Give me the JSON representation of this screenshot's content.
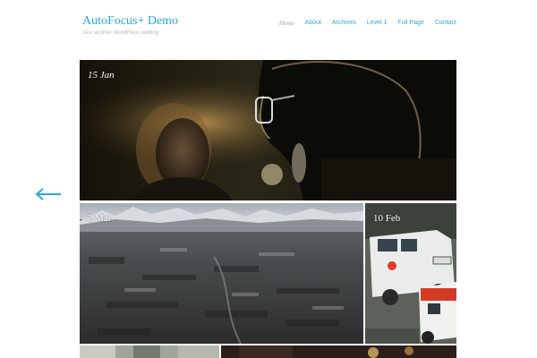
{
  "site": {
    "title": "AutoFocus+ Demo",
    "description": "Just another WordPress weblog"
  },
  "nav": [
    {
      "label": "Home",
      "current": true
    },
    {
      "label": "About"
    },
    {
      "label": "Archives"
    },
    {
      "label": "Level 1"
    },
    {
      "label": "Full Page"
    },
    {
      "label": "Contact"
    }
  ],
  "posts": [
    {
      "date": "15 Jan"
    },
    {
      "date": "2 Mar"
    },
    {
      "date": "10 Feb"
    }
  ],
  "colors": {
    "accent": "#29a9e0",
    "nav_current": "#a0a0a0",
    "tagline": "#b7b7b7"
  },
  "icons": {
    "prev": "left-arrow-icon"
  }
}
